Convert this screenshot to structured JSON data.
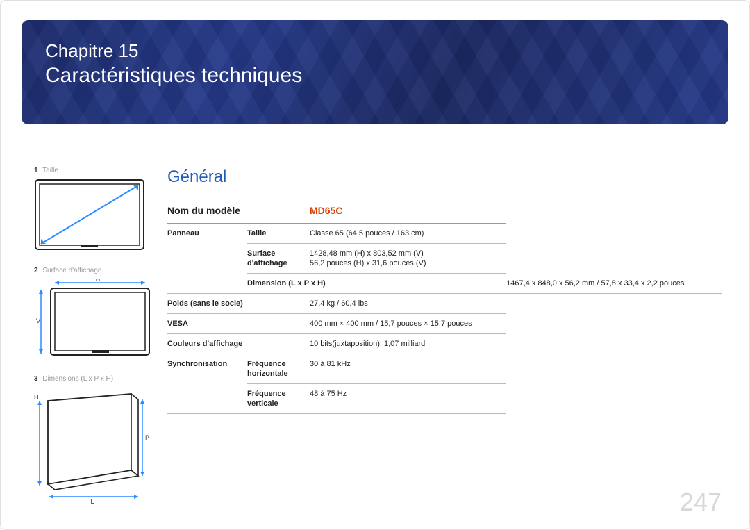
{
  "banner": {
    "chapter": "Chapitre 15",
    "title": "Caractéristiques techniques"
  },
  "figs": {
    "f1num": "1",
    "f1label": "Taille",
    "f2num": "2",
    "f2label": "Surface d'affichage",
    "f2H": "H",
    "f2V": "V",
    "f3num": "3",
    "f3label": "Dimensions (L x P x H)",
    "f3H": "H",
    "f3P": "P",
    "f3L": "L"
  },
  "section_heading": "Général",
  "model_label": "Nom du modèle",
  "model_value": "MD65C",
  "rows": {
    "panel_label": "Panneau",
    "size_label": "Taille",
    "size_val": "Classe 65 (64,5 pouces / 163 cm)",
    "disp_label1": "Surface",
    "disp_label2": "d'affichage",
    "disp_val1": "1428,48 mm (H) x 803,52 mm (V)",
    "disp_val2": "56,2 pouces (H) x 31,6 pouces (V)",
    "dim_label": "Dimension (L x P x H)",
    "dim_val": "1467,4 x 848,0 x 56,2 mm / 57,8 x 33,4 x 2,2 pouces",
    "weight_label": "Poids (sans le socle)",
    "weight_val": "27,4 kg / 60,4 lbs",
    "vesa_label": "VESA",
    "vesa_val": "400 mm × 400 mm / 15,7 pouces × 15,7 pouces",
    "colors_label": "Couleurs d'affichage",
    "colors_val": "10 bits(juxtaposition), 1,07 milliard",
    "sync_label": "Synchronisation",
    "hf_label1": "Fréquence",
    "hf_label2": "horizontale",
    "hf_val": "30 à 81 kHz",
    "vf_label1": "Fréquence",
    "vf_label2": "verticale",
    "vf_val": "48 à 75 Hz"
  },
  "page_number": "247"
}
